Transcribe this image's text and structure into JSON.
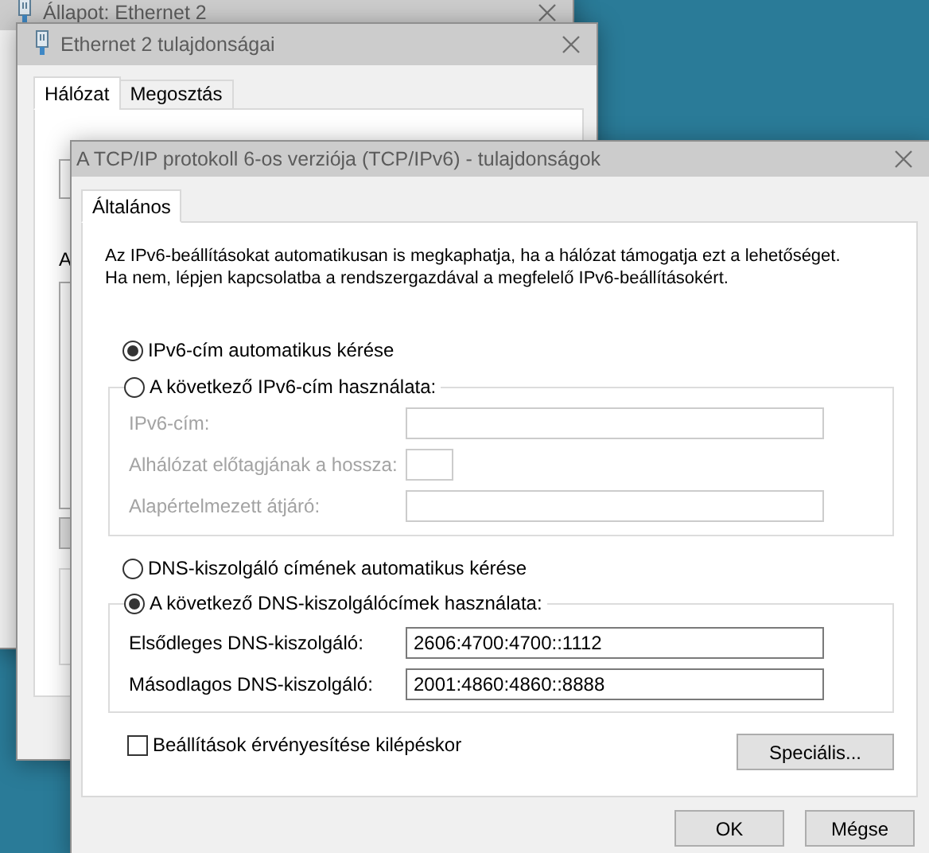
{
  "status_window": {
    "title": "Állapot: Ethernet 2"
  },
  "properties_window": {
    "title": "Ethernet 2 tulajdonságai",
    "tabs": [
      {
        "label": "Hálózat",
        "selected": true
      },
      {
        "label": "Megosztás",
        "selected": false
      }
    ],
    "partial_label": "A"
  },
  "ipv6_dialog": {
    "title": "A TCP/IP protokoll 6-os verziója (TCP/IPv6) - tulajdonságok",
    "tabs": [
      {
        "label": "Általános",
        "selected": true
      }
    ],
    "description": "Az IPv6-beállításokat automatikusan is megkaphatja, ha a hálózat támogatja ezt a lehetőséget.\nHa nem, lépjen kapcsolatba a rendszergazdával a megfelelő IPv6-beállításokért.",
    "address_options": [
      {
        "label": "IPv6-cím automatikus kérése",
        "selected": true
      },
      {
        "label": "A következő IPv6-cím használata:",
        "selected": false
      }
    ],
    "address_fields": [
      {
        "label": "IPv6-cím:",
        "kind": "wide",
        "disabled": true
      },
      {
        "label": "Alhálózat előtagjának a hossza:",
        "kind": "narrow",
        "disabled": true
      },
      {
        "label": "Alapértelmezett átjáró:",
        "kind": "wide",
        "disabled": true
      }
    ],
    "dns_options": [
      {
        "label": "DNS-kiszolgáló címének automatikus kérése",
        "selected": false
      },
      {
        "label": "A következő DNS-kiszolgálócímek használata:",
        "selected": true
      }
    ],
    "dns_fields": [
      {
        "label": "Elsődleges DNS-kiszolgáló:",
        "value": "2606:4700:4700::1112",
        "kind": "wide",
        "disabled": false
      },
      {
        "label": "Másodlagos DNS-kiszolgáló:",
        "value": "2001:4860:4860::8888",
        "kind": "wide",
        "disabled": false
      }
    ],
    "validate_on_exit": {
      "label": "Beállítások érvényesítése kilépéskor",
      "checked": false
    },
    "advanced_button": "Speciális...",
    "buttons": [
      "OK",
      "Mégse"
    ]
  }
}
